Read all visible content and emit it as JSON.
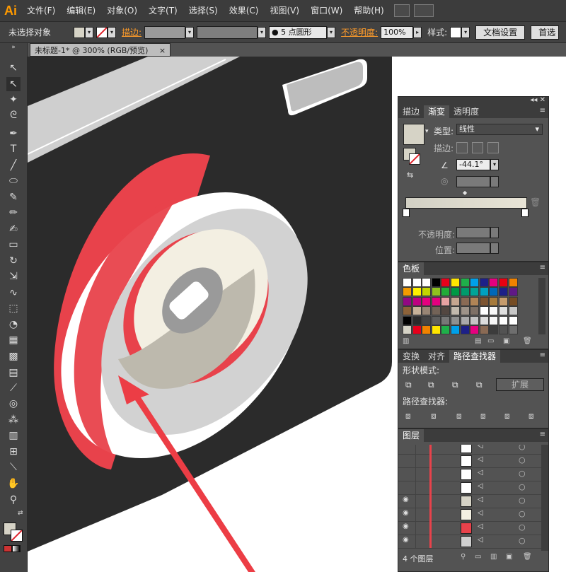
{
  "app": {
    "logo": "Ai"
  },
  "menubar": {
    "items": [
      "文件(F)",
      "编辑(E)",
      "对象(O)",
      "文字(T)",
      "选择(S)",
      "效果(C)",
      "视图(V)",
      "窗口(W)",
      "帮助(H)"
    ]
  },
  "controlbar": {
    "selection": "未选择对象",
    "stroke_label": "描边:",
    "brush": "5 点圆形",
    "opacity_label": "不透明度:",
    "opacity_value": "100%",
    "style_label": "样式:",
    "doc_settings": "文档设置",
    "prefs": "首选"
  },
  "document": {
    "tab_title": "未标题-1* @ 300% (RGB/预览)",
    "close": "×"
  },
  "gradient_panel": {
    "tabs": [
      "描边",
      "渐变",
      "透明度"
    ],
    "active_tab": "渐变",
    "type_label": "类型:",
    "type_value": "线性",
    "stroke_label": "描边:",
    "angle": "-44.1°",
    "opacity_label": "不透明度:",
    "position_label": "位置:"
  },
  "swatches_panel": {
    "title": "色板"
  },
  "pathfinder_panel": {
    "tabs": [
      "变换",
      "对齐",
      "路径查找器"
    ],
    "active_tab": "路径查找器",
    "shape_modes_label": "形状模式:",
    "expand": "扩展",
    "pathfinders_label": "路径查找器:"
  },
  "layers_panel": {
    "title": "图层",
    "count": "4 个图层"
  },
  "colors": {
    "accent_orange": "#ff9a00",
    "camera_body": "#2b2b2b",
    "lens_red": "#e8424b",
    "lens_gray": "#d2d2d2",
    "lens_cream": "#f3efe2",
    "arrow_red": "#ec3d45"
  }
}
